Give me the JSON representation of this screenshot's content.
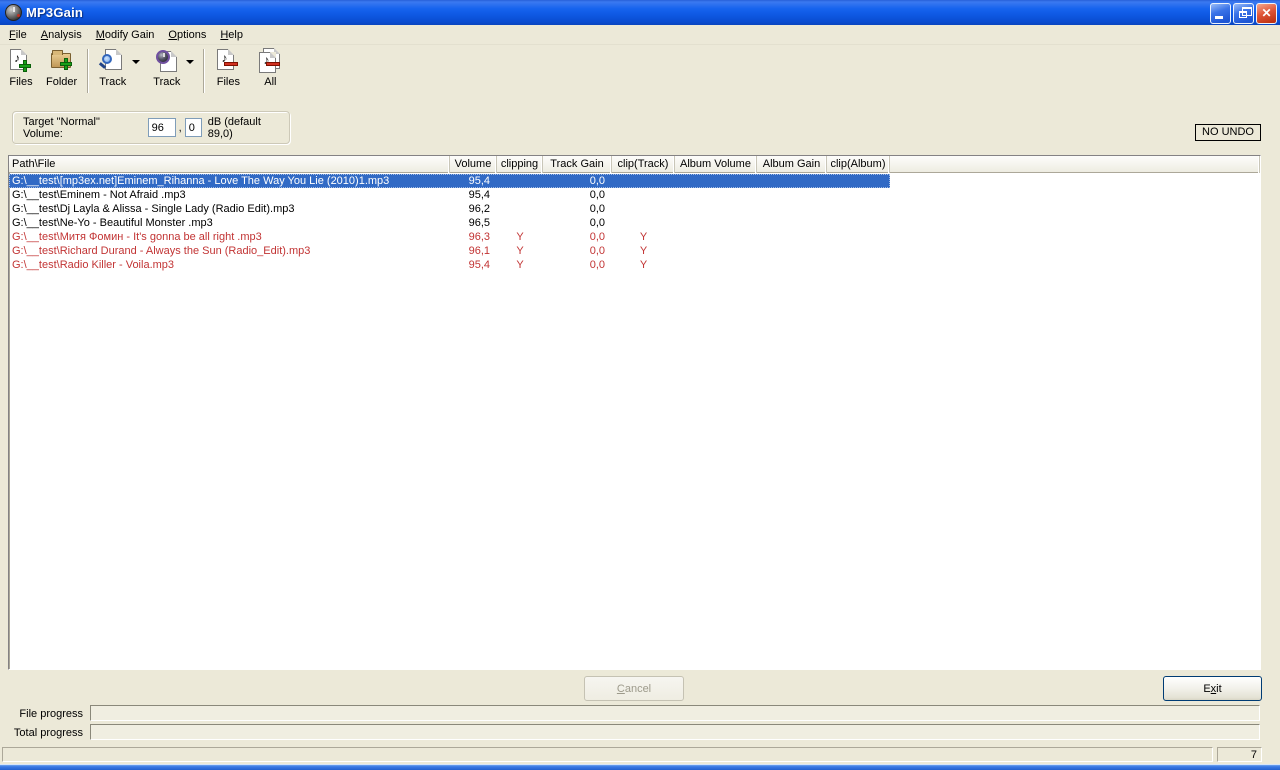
{
  "window": {
    "title": "MP3Gain"
  },
  "menu": {
    "items": [
      {
        "label": "File",
        "accel": 0
      },
      {
        "label": "Analysis",
        "accel": 0
      },
      {
        "label": "Modify Gain",
        "accel": 0
      },
      {
        "label": "Options",
        "accel": 0
      },
      {
        "label": "Help",
        "accel": 0
      }
    ]
  },
  "toolbar": {
    "buttons": [
      {
        "id": "add-files",
        "label": "Files"
      },
      {
        "id": "add-folder",
        "label": "Folder"
      },
      {
        "id": "track-analysis",
        "label": "Track"
      },
      {
        "id": "track-gain",
        "label": "Track"
      },
      {
        "id": "clear-files",
        "label": "Files"
      },
      {
        "id": "clear-all",
        "label": "All"
      }
    ]
  },
  "target_volume": {
    "label": "Target \"Normal\" Volume:",
    "whole": "96",
    "comma": ",",
    "fraction": "0",
    "suffix": "dB  (default 89,0)"
  },
  "no_undo": "NO UNDO",
  "table": {
    "columns": [
      {
        "label": "Path\\File"
      },
      {
        "label": "Volume"
      },
      {
        "label": "clipping"
      },
      {
        "label": "Track Gain"
      },
      {
        "label": "clip(Track)"
      },
      {
        "label": "Album Volume"
      },
      {
        "label": "Album Gain"
      },
      {
        "label": "clip(Album)"
      }
    ],
    "rows": [
      {
        "path": "G:\\__test\\[mp3ex.net]Eminem_Rihanna - Love The Way You Lie (2010)1.mp3",
        "volume": "95,4",
        "clipping": "",
        "track_gain": "0,0",
        "clip_track": "",
        "album_volume": "",
        "album_gain": "",
        "clip_album": "",
        "selected": true,
        "warn": false
      },
      {
        "path": "G:\\__test\\Eminem - Not Afraid .mp3",
        "volume": "95,4",
        "clipping": "",
        "track_gain": "0,0",
        "clip_track": "",
        "album_volume": "",
        "album_gain": "",
        "clip_album": "",
        "selected": false,
        "warn": false
      },
      {
        "path": "G:\\__test\\Dj Layla & Alissa - Single Lady (Radio Edit).mp3",
        "volume": "96,2",
        "clipping": "",
        "track_gain": "0,0",
        "clip_track": "",
        "album_volume": "",
        "album_gain": "",
        "clip_album": "",
        "selected": false,
        "warn": false
      },
      {
        "path": "G:\\__test\\Ne-Yo - Beautiful Monster .mp3",
        "volume": "96,5",
        "clipping": "",
        "track_gain": "0,0",
        "clip_track": "",
        "album_volume": "",
        "album_gain": "",
        "clip_album": "",
        "selected": false,
        "warn": false
      },
      {
        "path": "G:\\__test\\Митя Фомин -  It's gonna be all right .mp3",
        "volume": "96,3",
        "clipping": "Y",
        "track_gain": "0,0",
        "clip_track": "Y",
        "album_volume": "",
        "album_gain": "",
        "clip_album": "",
        "selected": false,
        "warn": true
      },
      {
        "path": "G:\\__test\\Richard Durand - Always the Sun (Radio_Edit).mp3",
        "volume": "96,1",
        "clipping": "Y",
        "track_gain": "0,0",
        "clip_track": "Y",
        "album_volume": "",
        "album_gain": "",
        "clip_album": "",
        "selected": false,
        "warn": true
      },
      {
        "path": "G:\\__test\\Radio Killer - Voila.mp3",
        "volume": "95,4",
        "clipping": "Y",
        "track_gain": "0,0",
        "clip_track": "Y",
        "album_volume": "",
        "album_gain": "",
        "clip_album": "",
        "selected": false,
        "warn": true
      }
    ]
  },
  "buttons": {
    "cancel": {
      "label": "Cancel",
      "accel": 0
    },
    "exit": {
      "label": "Exit",
      "accel": 1
    }
  },
  "progress": {
    "file_label": "File progress",
    "total_label": "Total progress"
  },
  "status_bar": {
    "count": "7"
  },
  "colors": {
    "selection": "#316AC5",
    "warn": "#C23434",
    "titlebar": "#1159E8"
  }
}
